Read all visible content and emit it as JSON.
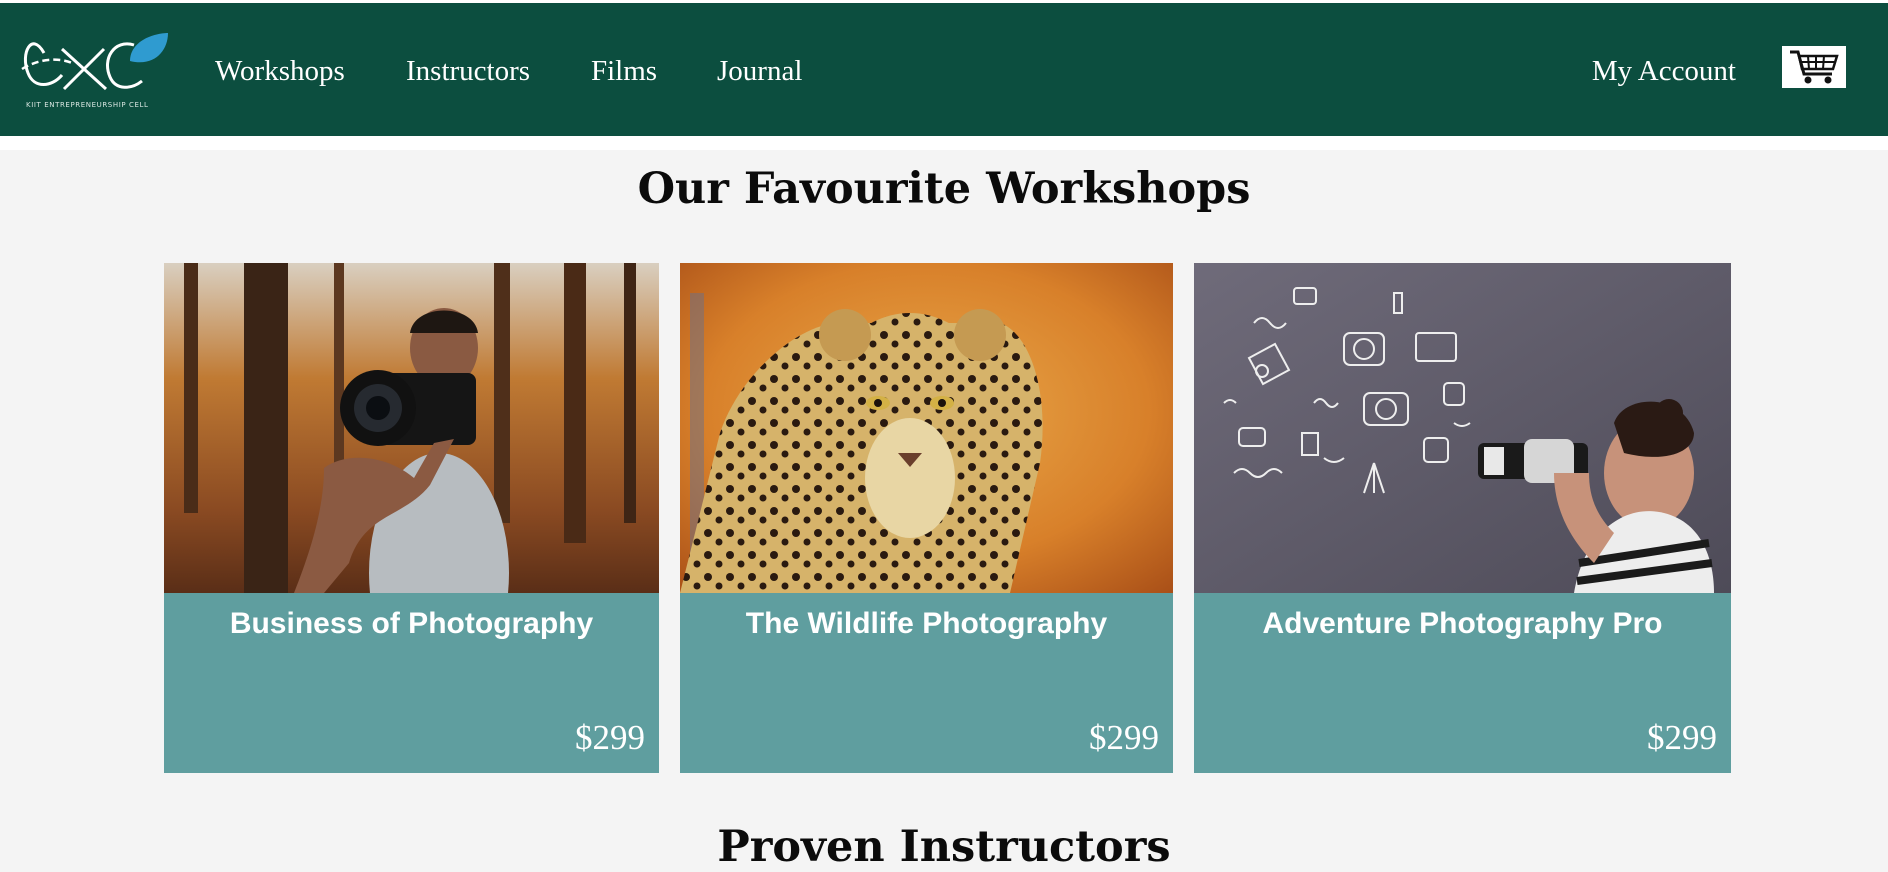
{
  "header": {
    "logo_tagline": "KIIT ENTREPRENEURSHIP CELL",
    "nav": {
      "workshops": "Workshops",
      "instructors": "Instructors",
      "films": "Films",
      "journal": "Journal"
    },
    "account_label": "My Account",
    "cart_icon": "shopping-cart-icon"
  },
  "colors": {
    "navbar": "#0c4e3f",
    "card_footer": "#5f9e9f",
    "logo_leaf": "#2f9bd0",
    "page_background": "#f4f4f4"
  },
  "workshops_section": {
    "title": "Our Favourite Workshops",
    "cards": [
      {
        "title": "Business of Photography",
        "price": "$299",
        "image": "photographer tossing camera in autumn forest"
      },
      {
        "title": "The Wildlife Photography",
        "price": "$299",
        "image": "leopard portrait"
      },
      {
        "title": "Adventure Photography Pro",
        "price": "$299",
        "image": "woman with telephoto camera and chalk doodles"
      }
    ]
  },
  "instructors_section": {
    "title": "Proven Instructors"
  }
}
